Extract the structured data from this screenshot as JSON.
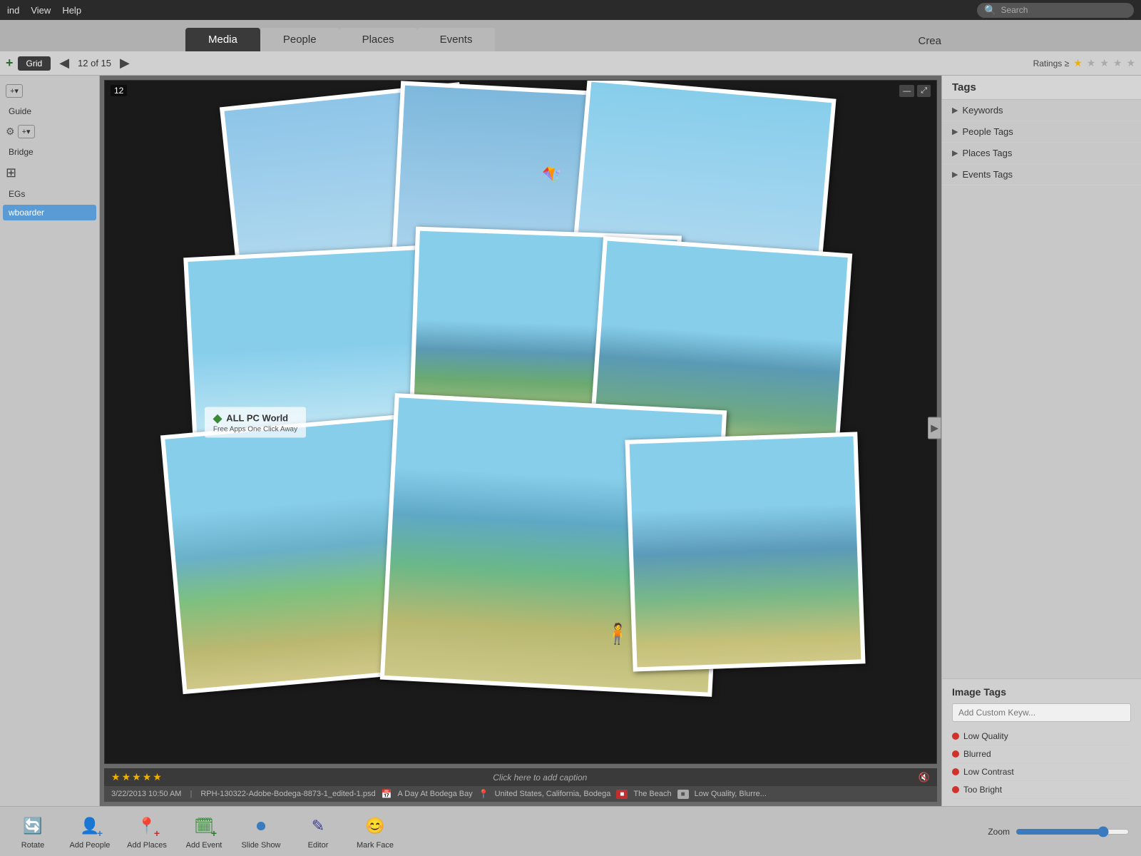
{
  "menu": {
    "items": [
      "ind",
      "View",
      "Help"
    ],
    "search_placeholder": "Search"
  },
  "tabs": {
    "items": [
      "Media",
      "People",
      "Places",
      "Events"
    ],
    "active": "Media",
    "create_label": "Crea"
  },
  "toolbar": {
    "grid_label": "Grid",
    "counter": "12 of 15",
    "ratings_label": "Ratings ≥",
    "add_label": "+"
  },
  "left_sidebar": {
    "items": [
      "Guide",
      "Bridge",
      "EGs",
      "wboarder"
    ],
    "selected_index": 3
  },
  "image": {
    "number": "12",
    "caption": "Click here to add caption",
    "date_time": "3/22/2013 10:50 AM",
    "filename": "RPH-130322-Adobe-Bodega-8873-1_edited-1.psd",
    "location_icon": "📅",
    "event": "A Day At Bodega Bay",
    "place": "United States, California, Bodega",
    "tag": "The Beach",
    "extra_tags": "Low Quality, Blurre...",
    "stars": 5,
    "watermark_title": "ALL PC World",
    "watermark_sub": "Free Apps One Click Away"
  },
  "right_panel": {
    "tags_title": "Tags",
    "tag_items": [
      {
        "label": "Keywords"
      },
      {
        "label": "People Tags"
      },
      {
        "label": "Places Tags"
      },
      {
        "label": "Events Tags"
      }
    ],
    "image_tags_title": "Image Tags",
    "keyword_placeholder": "Add Custom Keyw...",
    "image_tag_list": [
      {
        "label": "Low Quality"
      },
      {
        "label": "Blurred"
      },
      {
        "label": "Low Contrast"
      },
      {
        "label": "Too Bright"
      }
    ]
  },
  "bottom_toolbar": {
    "tools": [
      {
        "icon": "🔄",
        "label": "Rotate",
        "name": "rotate-tool"
      },
      {
        "icon": "👤",
        "label": "Add People",
        "name": "add-people-tool"
      },
      {
        "icon": "📍",
        "label": "Add Places",
        "name": "add-places-tool"
      },
      {
        "icon": "📅",
        "label": "Add Event",
        "name": "add-event-tool"
      },
      {
        "icon": "▶",
        "label": "Slide Show",
        "name": "slideshow-tool"
      },
      {
        "icon": "✏️",
        "label": "Editor",
        "name": "editor-tool"
      },
      {
        "icon": "😊",
        "label": "Mark Face",
        "name": "mark-face-tool"
      }
    ],
    "zoom_label": "Zoom"
  }
}
